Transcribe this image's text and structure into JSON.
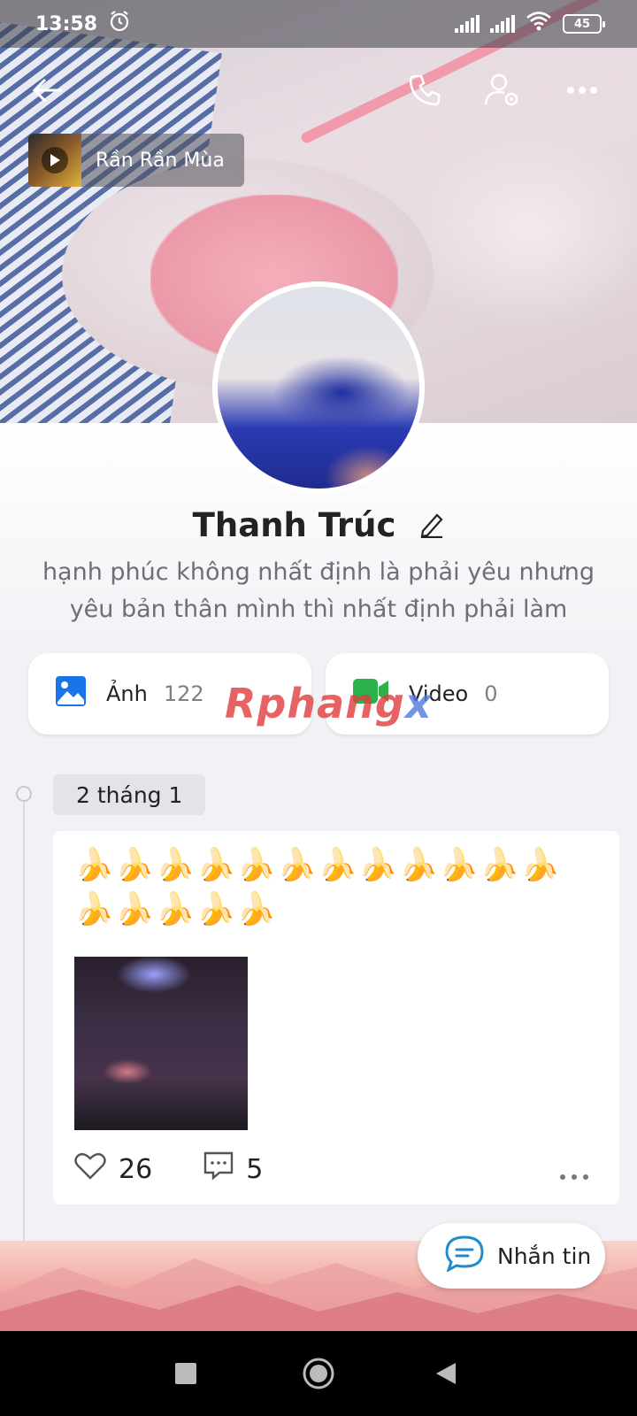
{
  "status_bar": {
    "time": "13:58",
    "battery": "45"
  },
  "music": {
    "title": "Rần Rần Mùa"
  },
  "profile": {
    "name": "Thanh Trúc",
    "bio_line1": "hạnh phúc không nhất định là phải yêu nhưng",
    "bio_line2": "yêu bản thân mình thì nhất định phải làm"
  },
  "media": {
    "photos": {
      "label": "Ảnh",
      "count": "122"
    },
    "videos": {
      "label": "Video",
      "count": "0"
    }
  },
  "watermark": {
    "part1": "Rphang",
    "part2": "x"
  },
  "timeline": {
    "date": "2 tháng 1",
    "post": {
      "emoji_line1": "🍌🍌🍌🍌🍌🍌🍌🍌🍌🍌🍌🍌",
      "emoji_line2": "🍌🍌🍌🍌🍌",
      "likes": "26",
      "comments": "5"
    }
  },
  "message_button": {
    "label": "Nhắn tin"
  },
  "colors": {
    "accent": "#1a73e8",
    "video_green": "#2bb24c",
    "message_blue": "#1f8ccc"
  }
}
